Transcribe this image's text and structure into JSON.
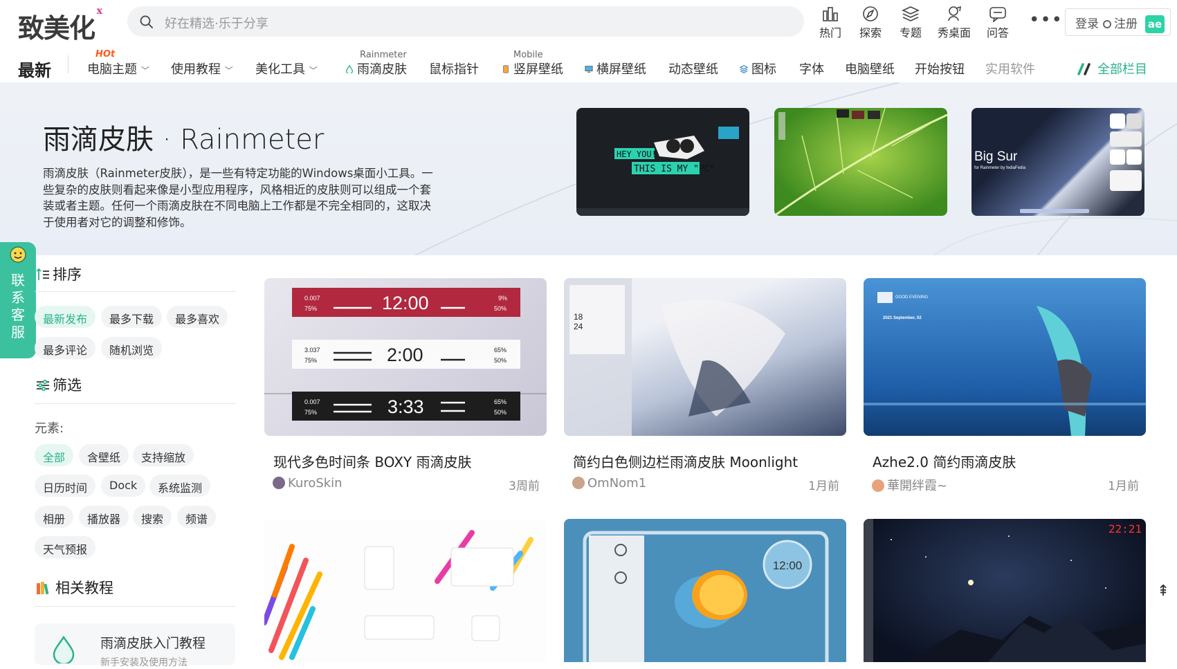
{
  "header": {
    "logo": "致美化",
    "search_placeholder": "好在精选·乐于分享",
    "icons": [
      {
        "label": "热门",
        "icon": "hot-icon"
      },
      {
        "label": "探索",
        "icon": "explore-icon"
      },
      {
        "label": "专题",
        "icon": "topic-icon"
      },
      {
        "label": "秀桌面",
        "icon": "desktop-show-icon"
      },
      {
        "label": "问答",
        "icon": "qa-icon"
      }
    ],
    "more": "•••",
    "login": "登录",
    "register": "注册",
    "ae_logo": "ae"
  },
  "nav": {
    "latest": "最新",
    "items": [
      {
        "label": "电脑主题",
        "badge": "HOt",
        "has_dropdown": true
      },
      {
        "label": "使用教程",
        "has_dropdown": true
      },
      {
        "label": "美化工具",
        "has_dropdown": true
      },
      {
        "label": "雨滴皮肤",
        "sup": "Rainmeter"
      },
      {
        "label": "鼠标指针"
      },
      {
        "label": "竖屏壁纸",
        "sup": "Mobile"
      },
      {
        "label": "横屏壁纸"
      },
      {
        "label": "动态壁纸"
      },
      {
        "label": "图标"
      },
      {
        "label": "字体"
      },
      {
        "label": "电脑壁纸"
      },
      {
        "label": "开始按钮"
      },
      {
        "label": "实用软件"
      }
    ],
    "all_columns": "全部栏目",
    "dropdown_caret": "﹀"
  },
  "hero": {
    "title": "雨滴皮肤 · Rainmeter",
    "description": "雨滴皮肤（Rainmeter皮肤），是一些有特定功能的Windows桌面小工具。一些复杂的皮肤则看起来像是小型应用程序，风格相近的皮肤则可以组成一个套装或者主题。任何一个雨滴皮肤在不同电脑上工作都是不完全相同的，这取决于使用者对它的调整和修饰。",
    "thumbs": [
      {
        "text1": "HEY YOU!",
        "text2": "THIS IS MY \"PC\""
      },
      {
        "text1": ""
      },
      {
        "text1": "Big Sur",
        "text2": "for Rainmeter by fediaFedia"
      }
    ]
  },
  "contact": {
    "label": "联系客服"
  },
  "sidebar": {
    "sort_title": "排序",
    "sort_options": [
      {
        "label": "最新发布",
        "active": true
      },
      {
        "label": "最多下载",
        "active": false
      },
      {
        "label": "最多喜欢",
        "active": false
      },
      {
        "label": "最多评论",
        "active": false
      },
      {
        "label": "随机浏览",
        "active": false
      }
    ],
    "filter_title": "筛选",
    "element_label": "元素:",
    "elements": [
      {
        "label": "全部",
        "active": true
      },
      {
        "label": "含壁纸",
        "active": false
      },
      {
        "label": "支持缩放",
        "active": false
      },
      {
        "label": "日历时间",
        "active": false
      },
      {
        "label": "Dock",
        "active": false
      },
      {
        "label": "系统监测",
        "active": false
      },
      {
        "label": "相册",
        "active": false
      },
      {
        "label": "播放器",
        "active": false
      },
      {
        "label": "搜索",
        "active": false
      },
      {
        "label": "频谱",
        "active": false
      },
      {
        "label": "天气预报",
        "active": false
      }
    ],
    "tutorial_title": "相关教程",
    "tutorial_card": {
      "title": "雨滴皮肤入门教程",
      "subtitle": "新手安装及使用方法"
    }
  },
  "cards": [
    {
      "title": "现代多色时间条 BOXY 雨滴皮肤",
      "author": "KuroSkin",
      "time": "3周前",
      "bars": [
        {
          "left_top": "0.007",
          "left_bottom": "75%",
          "clock": "12:00",
          "right_top": "9%",
          "right_bottom": "50%"
        },
        {
          "left_top": "3.037",
          "left_bottom": "75%",
          "clock": "2:00",
          "right_top": "65%",
          "right_bottom": "50%"
        },
        {
          "left_top": "0.007",
          "left_bottom": "75%",
          "clock": "3:33",
          "right_top": "65%",
          "right_bottom": "50%"
        }
      ]
    },
    {
      "title": "简约白色侧边栏雨滴皮肤 Moonlight",
      "author": "OmNom1",
      "time": "1月前",
      "side_date_top": "18",
      "side_date_bottom": "24"
    },
    {
      "title": "Azhe2.0 简约雨滴皮肤",
      "author": "華開绊霞~",
      "time": "1月前",
      "greeting": "GOOD EVENING",
      "date_text": "2021 September, 02"
    },
    {
      "title": "",
      "author": "",
      "time": ""
    },
    {
      "title": "",
      "author": "",
      "time": "",
      "clock": "12:00"
    },
    {
      "title": "",
      "author": "",
      "time": "",
      "clock": "22:21"
    }
  ],
  "back_to_top": "⇞",
  "colors": {
    "accent": "#2ab38c",
    "hot": "#ff5a1f",
    "contact": "#3cc19e"
  }
}
